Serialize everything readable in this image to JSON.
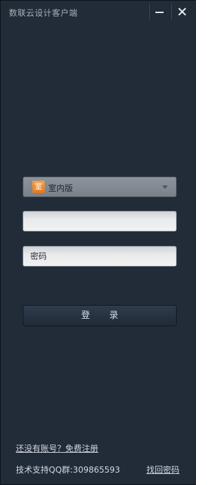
{
  "window": {
    "title": "数联云设计客户端",
    "controls": {
      "minimize_icon": "minimize-icon",
      "close_icon": "close-icon"
    }
  },
  "form": {
    "version_select": {
      "icon_label": "室",
      "selected": "室内版"
    },
    "username": {
      "value": ""
    },
    "password": {
      "placeholder": "密码"
    },
    "login_label": "登录"
  },
  "footer": {
    "register_link": "还没有账号？免费注册",
    "support_text": "技术支持QQ群:309865593",
    "recover_link": "找回密码"
  },
  "colors": {
    "window_bg": "#222b38",
    "accent": "#e27b20",
    "text_light": "#d2d8df"
  }
}
